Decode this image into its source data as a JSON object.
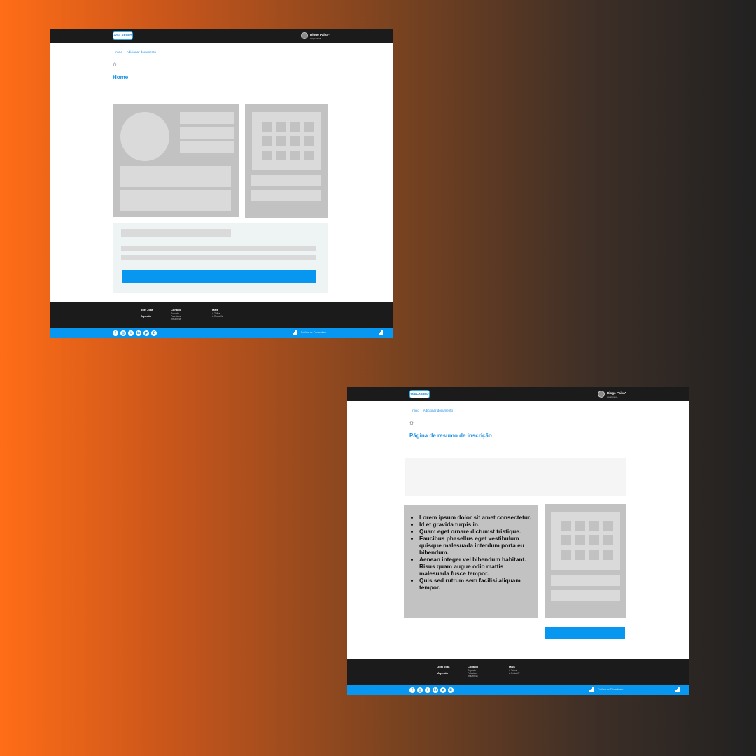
{
  "background": {
    "colors": [
      "#ff6d17",
      "#212121"
    ]
  },
  "header": {
    "logo_text": "eduLAB/IED",
    "user_name": "Diogo Paiva",
    "user_role": "diogo.paiva",
    "caret": "▾"
  },
  "breadcrumb": {
    "home": "Início",
    "current": "Adicionar documento"
  },
  "screens": [
    {
      "title": "Home"
    },
    {
      "title": "Página de resumo de inscrição",
      "list_items": [
        "Lorem ipsum dolor sit amet consectetur.",
        "Id et gravida turpis in.",
        "Quam eget ornare dictumst tristique.",
        "Faucibus phasellus eget vestibulum quisque malesuada interdum porta eu bibendum.",
        "Aenean integer vel bibendum habitant. Risus quam augue odio mattis malesuada fusce tempor.",
        "Quis sed rutrum sem facilisi aliquam tempor."
      ]
    }
  ],
  "footer": {
    "col1": {
      "item1": "Joel Jota",
      "item2": "Agenda"
    },
    "col2": {
      "heading": "Contato",
      "links": [
        "Suporte",
        "Palestras",
        "Influência"
      ]
    },
    "col3": {
      "heading": "Mais",
      "links": [
        "A Trilha",
        "A Roda W"
      ]
    },
    "privacy": "Política de Privacidade",
    "social_icons": [
      "facebook-icon",
      "instagram-icon",
      "twitter-icon",
      "linkedin-icon",
      "youtube-icon",
      "whatsapp-icon"
    ]
  },
  "colors": {
    "accent": "#0796f0",
    "dark": "#1b1b1b",
    "placeholder": "#c2c2c2"
  }
}
